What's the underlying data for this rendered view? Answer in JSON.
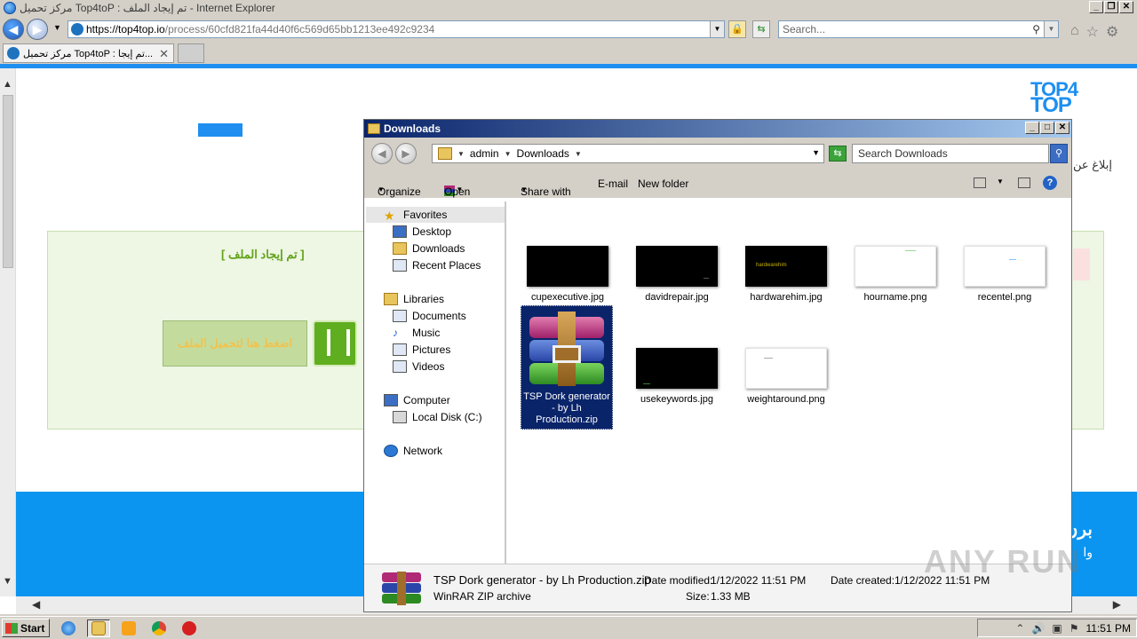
{
  "browser": {
    "title": "مركز تحميل Top4toP : تم إيجاد الملف - Internet Explorer",
    "url_host": "https://top4top.io",
    "url_path": "/process/60cfd821fa44d40f6c569d65bb1213ee492c9234",
    "search_placeholder": "Search...",
    "tab_title": "مركز تحميل Top4toP : تم إيجا..."
  },
  "page": {
    "logo_line1": "TOP4",
    "logo_line2": "TOP",
    "report_text": "إبلاغ عن",
    "file_found": "[ تم إيجاد الملف ]",
    "download_button": "اضغط هنا لتحميل الملف",
    "footer_text1": "برن",
    "footer_text2": "وا"
  },
  "explorer": {
    "title": "Downloads",
    "breadcrumb": [
      "admin",
      "Downloads"
    ],
    "search_placeholder": "Search Downloads",
    "commands": {
      "organize": "Organize",
      "open": "Open",
      "share_with": "Share with",
      "email": "E-mail",
      "new_folder": "New folder"
    },
    "nav": {
      "favorites": "Favorites",
      "desktop": "Desktop",
      "downloads": "Downloads",
      "recent_places": "Recent Places",
      "libraries": "Libraries",
      "documents": "Documents",
      "music": "Music",
      "pictures": "Pictures",
      "videos": "Videos",
      "computer": "Computer",
      "local_disk": "Local Disk (C:)",
      "network": "Network"
    },
    "files": [
      {
        "name": "cupexecutive.jpg"
      },
      {
        "name": "davidrepair.jpg"
      },
      {
        "name": "hardwarehim.jpg",
        "thumb_text": "hardwarehim"
      },
      {
        "name": "hourname.png"
      },
      {
        "name": "recentel.png"
      },
      {
        "name": "TSP Dork generator - by Lh Production.zip",
        "selected": true
      },
      {
        "name": "usekeywords.jpg"
      },
      {
        "name": "weightaround.png"
      }
    ],
    "status": {
      "filename": "TSP Dork generator - by Lh Production.zip",
      "type": "WinRAR ZIP archive",
      "modified_label": "Date modified:",
      "modified_value": "1/12/2022 11:51 PM",
      "size_label": "Size:",
      "size_value": "1.33 MB",
      "created_label": "Date created:",
      "created_value": "1/12/2022 11:51 PM"
    }
  },
  "watermark": "ANY RUN",
  "taskbar": {
    "start_label": "Start",
    "clock": "11:51 PM"
  },
  "colors": {
    "accent_blue": "#1e8ff0",
    "selection": "#0a246a",
    "green": "#62a21a"
  }
}
